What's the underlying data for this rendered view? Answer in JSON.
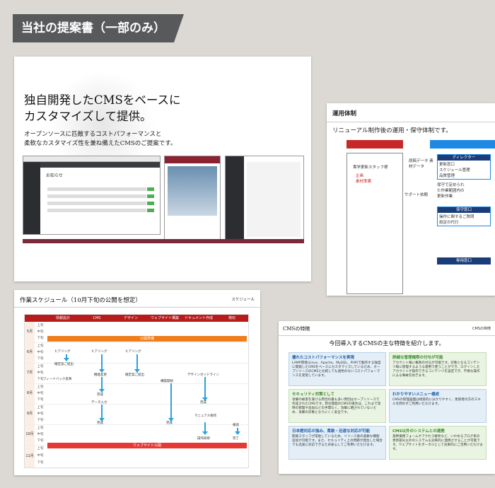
{
  "header_tag": "当社の提案書（一部のみ）",
  "card1": {
    "headline_line1": "独自開発したCMSをベースに",
    "headline_line2": "カスタマイズして提供。",
    "desc_line1": "オープンソースに匹敵するコストパフォーマンスと",
    "desc_line2": "柔軟なカスタマイズ性を兼ね備えたCMSのご提案です。",
    "screen_title": "お知らせ"
  },
  "card2": {
    "title": "運用体制",
    "subtitle": "リニューアル制作後の運用・保守体制です。",
    "staff_label": "貴学更新スタッフ様",
    "staff_items": [
      "企画",
      "素材準備"
    ],
    "flow1": "原稿データ 素材データ",
    "support": "サポート依頼",
    "director": "ディレクター",
    "director_items": [
      "更新窓口",
      "スケジュール管理",
      "品質管理"
    ],
    "maint_title": "保守窓口",
    "maint_items": [
      "操作に関するご質問",
      "設定の代行"
    ],
    "note": "保守で定められた作業範囲内の更新作業",
    "bottom": "専用窓口"
  },
  "card3": {
    "title": "作業スケジュール（10月下旬の公開を想定）",
    "tag": "スケジュール",
    "columns": [
      "情報設計",
      "CMS",
      "デザイン",
      "ウェブサイト構築",
      "ドキュメント作成",
      "検収"
    ],
    "months": [
      "5月",
      "6月",
      "7月",
      "8月",
      "9月",
      "10月",
      "11月"
    ],
    "halves": [
      "上旬",
      "中旬",
      "下旬"
    ],
    "kickoff": "公開準備",
    "launch": "ウェブサイト公開",
    "tasks": {
      "hearing1": "ヒアリング",
      "hearing2": "ヒアリング",
      "hearing3": "ヒアリング",
      "proposal": "確定案ご提出",
      "feedback": "フィードバック反映",
      "function": "機能変更",
      "design_proposal": "確定案ご提出",
      "build_start": "構築開始",
      "guideline": "デザインガイドライン",
      "done1": "完成",
      "data_input": "データ入力",
      "done2": "完成",
      "done3": "完成",
      "done4": "完成",
      "manual": "マニュアル製作",
      "training": "操作研修",
      "inspection": "検収",
      "complete": "完了"
    }
  },
  "card4": {
    "title": "CMSの特徴",
    "tag": "CMSの特徴",
    "subtitle": "今回導入するCMSの主な特徴を紹介します。",
    "features": [
      {
        "title": "優れたコストパフォーマンスを実現",
        "body": "LAMP環境(Linux、Apache、MySQL、PHP)で動作する独自に開発したCMSをベースにカスタマイズしているため、オープンソースのCMSと比較しても遜色のないコストパフォーマンスを実現しています。"
      },
      {
        "title": "詳細な管理権限の付与が可能",
        "body": "アカウント毎に権限の付与が可能です。対象となるコンテンツ毎に管理するような運用で使うことができ、ログインしたアカウントが操作できるコンテンツを設定でき、不要な操作による事故を防ぎます。"
      },
      {
        "title": "セキュリティ対策として",
        "body": "攻撃の被害を受ける原因の最も多い原因はオープンソースで作成されたCMSです。弊社開発のCMSの場合は、これまで常時の管理や追加などの手間なく、攻撃に晒されていないため、攻撃の対象となりにくく安全です。"
      },
      {
        "title": "わかりやすいメニュー構成",
        "body": "CMSの管理画面は視覚的に分かりやすく、更新者の方のスキルを問わずご利用いただけます。"
      },
      {
        "title": "日本語対応の強み、柔軟・迅速な対応が可能",
        "body": "開発スタッフが常駐しているため、リリース後の柔軟な機能追加が可能です。また、セキュリティ上の問題が発生した場合でも迅速に対応できるため安心してご利用いただけます。"
      },
      {
        "title": "CMS以外のシステムとの連携",
        "body": "基幹業務フォームやアクセス解析など、いわゆるブログ系の更新部分以外のシステムも効率的に連携させることが可能です。ウェブサイトをポータルとして効果的にご活用いただけます。"
      }
    ]
  }
}
